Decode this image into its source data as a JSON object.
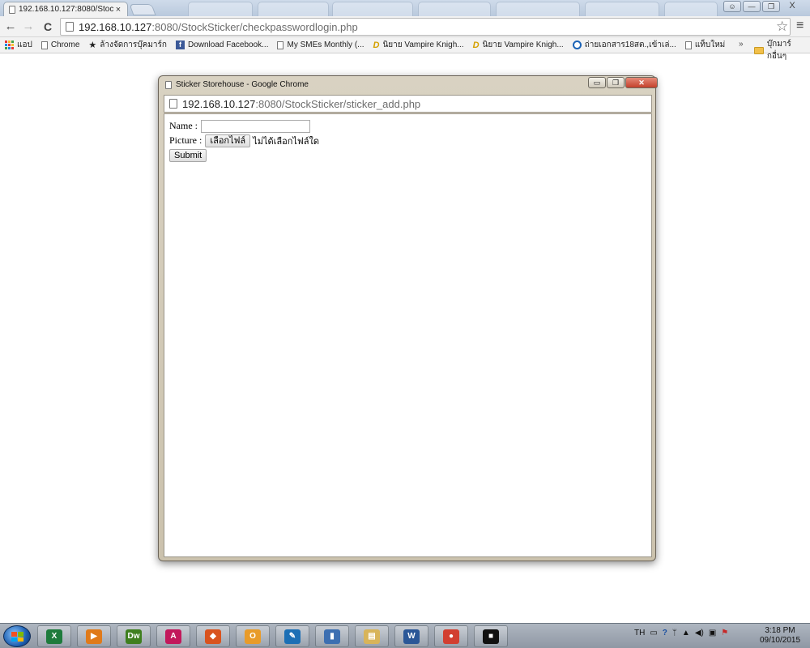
{
  "browser": {
    "active_tab_title": "192.168.10.127:8080/Stoc",
    "tab_close": "×",
    "url_host": "192.168.10.127",
    "url_rest": ":8080/StockSticker/checkpasswordlogin.php",
    "back": "←",
    "forward": "→",
    "reload": "C",
    "star": "☆",
    "menu": "≡",
    "minimize": "—",
    "restore": "❐",
    "close": "X"
  },
  "bookmarks": {
    "apps_label": "แอป",
    "items": [
      {
        "label": "Chrome",
        "icon": "page-icon"
      },
      {
        "label": "ล้างจัดการบุ๊คมาร์ก",
        "icon": "star-icon"
      },
      {
        "label": "Download Facebook...",
        "icon": "facebook-icon"
      },
      {
        "label": "My SMEs Monthly (...",
        "icon": "page-icon"
      },
      {
        "label": "นิยาย Vampire Knigh...",
        "icon": "dek-d-icon"
      },
      {
        "label": "นิยาย Vampire Knigh...",
        "icon": "dek-d-icon"
      },
      {
        "label": "ถ่ายเอกสาร18สต.,เข้าเล่...",
        "icon": "circle-icon"
      },
      {
        "label": "แท็บใหม่",
        "icon": "page-icon"
      }
    ],
    "overflow": "»",
    "other_bookmarks": "บุ๊กมาร์กอื่นๆ"
  },
  "popup": {
    "title": "Sticker Storehouse - Google Chrome",
    "url_host": "192.168.10.127",
    "url_rest": ":8080/StockSticker/sticker_add.php",
    "minimize": "▭",
    "restore": "❐",
    "close": "✕",
    "form": {
      "name_label": "Name :",
      "name_value": "",
      "picture_label": "Picture :",
      "file_button": "เลือกไฟล์",
      "file_status": "ไม่ได้เลือกไฟล์ใด",
      "submit": "Submit"
    }
  },
  "taskbar": {
    "apps": [
      {
        "name": "excel",
        "glyph": "X",
        "color": "#1e7b3c"
      },
      {
        "name": "media-player",
        "glyph": "▶",
        "color": "#e07a1a"
      },
      {
        "name": "dreamweaver",
        "glyph": "Dw",
        "color": "#3f7f1f"
      },
      {
        "name": "acrobat",
        "glyph": "A",
        "color": "#c2185b"
      },
      {
        "name": "ms-office",
        "glyph": "◆",
        "color": "#d9531e"
      },
      {
        "name": "outlook",
        "glyph": "O",
        "color": "#e89b2a"
      },
      {
        "name": "inkscape",
        "glyph": "✎",
        "color": "#1c6fb5"
      },
      {
        "name": "chart-tool",
        "glyph": "▮",
        "color": "#3d6fb1"
      },
      {
        "name": "file-explorer",
        "glyph": "▤",
        "color": "#d8b45a"
      },
      {
        "name": "word",
        "glyph": "W",
        "color": "#2b5797"
      },
      {
        "name": "chrome",
        "glyph": "●",
        "color": "#d23f31"
      },
      {
        "name": "cmd-window",
        "glyph": "■",
        "color": "#111111"
      }
    ],
    "language": "TH",
    "time": "3:18 PM",
    "date": "09/10/2015"
  }
}
